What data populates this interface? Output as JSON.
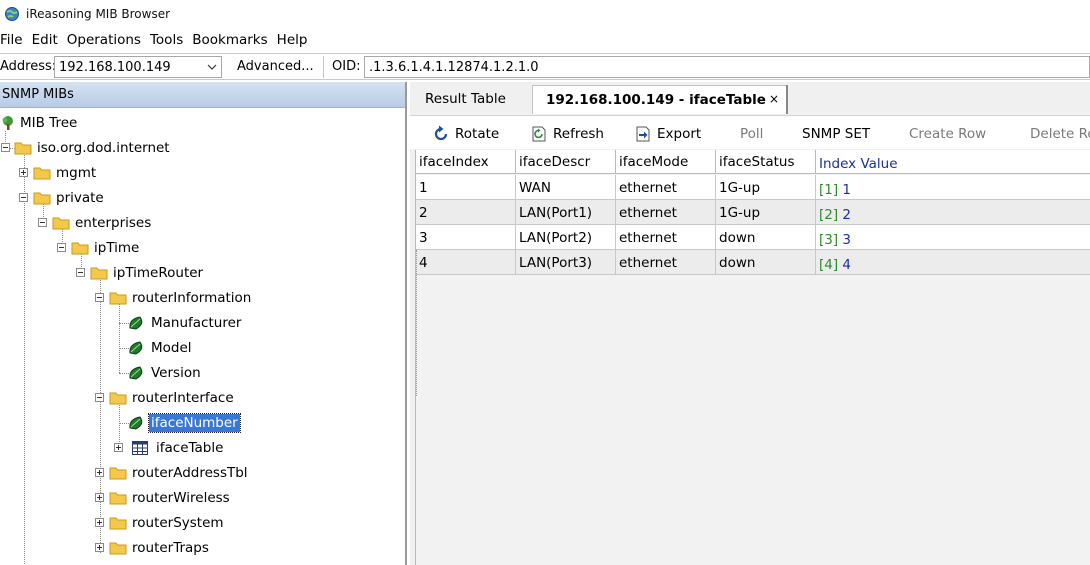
{
  "window": {
    "title": "iReasoning MIB Browser"
  },
  "menu": [
    "File",
    "Edit",
    "Operations",
    "Tools",
    "Bookmarks",
    "Help"
  ],
  "address_bar": {
    "address_label": "Address:",
    "address_value": "192.168.100.149",
    "advanced_label": "Advanced...",
    "oid_label": "OID:",
    "oid_value": ".1.3.6.1.4.1.12874.1.2.1.0"
  },
  "left_pane": {
    "header": "SNMP MIBs",
    "tree": {
      "root": "MIB Tree",
      "internet": "iso.org.dod.internet",
      "mgmt": "mgmt",
      "private": "private",
      "enterprises": "enterprises",
      "iptime": "ipTime",
      "iptimerouter": "ipTimeRouter",
      "routerinformation": "routerInformation",
      "manufacturer": "Manufacturer",
      "model": "Model",
      "version": "Version",
      "routerinterface": "routerInterface",
      "ifacenumber": "ifaceNumber",
      "ifacetable": "ifaceTable",
      "routeraddresstbl": "routerAddressTbl",
      "routerwireless": "routerWireless",
      "routersystem": "routerSystem",
      "routertraps": "routerTraps"
    }
  },
  "tabs": {
    "result": "Result Table",
    "active": "192.168.100.149 - ifaceTable",
    "close": "×"
  },
  "toolbar": {
    "rotate": "Rotate",
    "refresh": "Refresh",
    "export": "Export",
    "poll": "Poll",
    "snmp_set": "SNMP SET",
    "create_row": "Create Row",
    "delete_row": "Delete Ro"
  },
  "table": {
    "columns": [
      "ifaceIndex",
      "ifaceDescr",
      "ifaceMode",
      "ifaceStatus",
      "Index Value"
    ],
    "rows": [
      {
        "index": "1",
        "descr": "WAN",
        "mode": "ethernet",
        "status": "1G-up",
        "idx_bracket": "[1]",
        "idx_value": "1"
      },
      {
        "index": "2",
        "descr": "LAN(Port1)",
        "mode": "ethernet",
        "status": "1G-up",
        "idx_bracket": "[2]",
        "idx_value": "2"
      },
      {
        "index": "3",
        "descr": "LAN(Port2)",
        "mode": "ethernet",
        "status": "down",
        "idx_bracket": "[3]",
        "idx_value": "3"
      },
      {
        "index": "4",
        "descr": "LAN(Port3)",
        "mode": "ethernet",
        "status": "down",
        "idx_bracket": "[4]",
        "idx_value": "4"
      }
    ]
  },
  "icons": {
    "app": "app-globe-icon",
    "tree_root": "tree-icon",
    "folder": "folder-icon",
    "leaf": "leaf-icon",
    "table": "table-icon",
    "rotate": "rotate-icon",
    "refresh": "refresh-icon",
    "export": "export-icon"
  },
  "colors": {
    "selection": "#3a78d6",
    "pane_header": "#c4d5ec",
    "index_bracket": "#2e8b2e",
    "index_value": "#1a2f9e"
  }
}
